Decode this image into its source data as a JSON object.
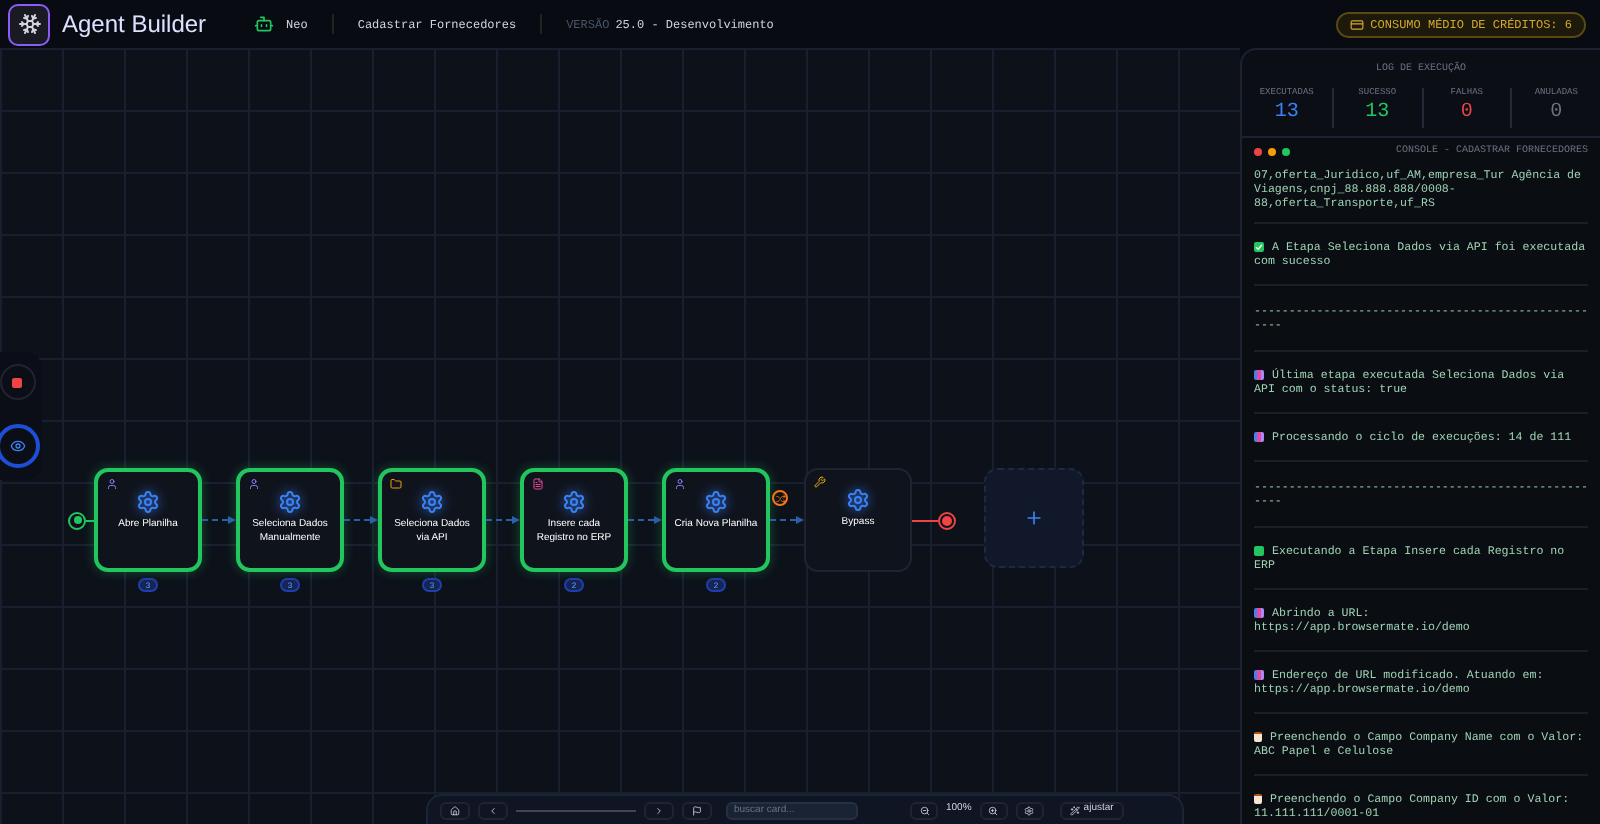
{
  "header": {
    "app_name": "Agent Builder",
    "agent": "Neo",
    "project": "Cadastrar Fornecedores",
    "version_label": "VERSÃO",
    "version": "25.0 - Desenvolvimento",
    "credits": "CONSUMO MÉDIO DE CRÉDITOS: 6"
  },
  "canvas": {
    "nodes": [
      {
        "label": "Abre Planilha",
        "kind": "person",
        "done": true,
        "count": "3"
      },
      {
        "label": "Seleciona Dados Manualmente",
        "kind": "person",
        "done": true,
        "count": "3"
      },
      {
        "label": "Seleciona Dados via API",
        "kind": "folder",
        "done": true,
        "count": "3"
      },
      {
        "label": "Insere cada Registro no ERP",
        "kind": "document",
        "done": true,
        "count": "2"
      },
      {
        "label": "Cria Nova Planilha",
        "kind": "person",
        "done": true,
        "count": "2"
      },
      {
        "label": "Bypass",
        "kind": "tool",
        "done": false,
        "shuffle_before": true
      }
    ]
  },
  "toolbar": {
    "search": {
      "placeholder": "buscar card..."
    },
    "zoom": "100%",
    "fit": "ajustar"
  },
  "log": {
    "title": "LOG DE EXECUÇÃO",
    "stats": [
      {
        "label": "EXECUTADAS",
        "value": "13",
        "color": "#3b82f6"
      },
      {
        "label": "SUCESSO",
        "value": "13",
        "color": "#22c55e"
      },
      {
        "label": "FALHAS",
        "value": "0",
        "color": "#ef4444"
      },
      {
        "label": "ANULADAS",
        "value": "0",
        "color": "#6b7280"
      }
    ]
  },
  "console": {
    "title": "CONSOLE - CADASTRAR FORNECEDORES",
    "entries": [
      {
        "kind": "data",
        "text": "07,oferta_Juridico,uf_AM,empresa_Tur Agência de Viagens,cnpj_88.888.888/0008-88,oferta_Transporte,uf_RS"
      },
      {
        "kind": "success",
        "text": "A Etapa Seleciona Dados via API foi executada com sucesso"
      },
      {
        "kind": "separator",
        "text": "----------------------------------------------------"
      },
      {
        "kind": "chart",
        "text": "Última etapa executada Seleciona Dados via API com o status: true"
      },
      {
        "kind": "chart",
        "text": "Processando o ciclo de execuções: 14 de 111"
      },
      {
        "kind": "separator",
        "text": "----------------------------------------------------"
      },
      {
        "kind": "running",
        "text": "Executando a Etapa Insere cada Registro no ERP"
      },
      {
        "kind": "chart",
        "text": "Abrindo a URL: https://app.browsermate.io/demo"
      },
      {
        "kind": "chart",
        "text": "Endereço de URL modificado. Atuando em: https://app.browsermate.io/demo"
      },
      {
        "kind": "clipboard",
        "text": "Preenchendo o Campo Company Name com o Valor: ABC Papel e Celulose"
      },
      {
        "kind": "clipboard",
        "text": "Preenchendo o Campo Company ID com o Valor: 11.111.111/0001-01"
      }
    ]
  }
}
